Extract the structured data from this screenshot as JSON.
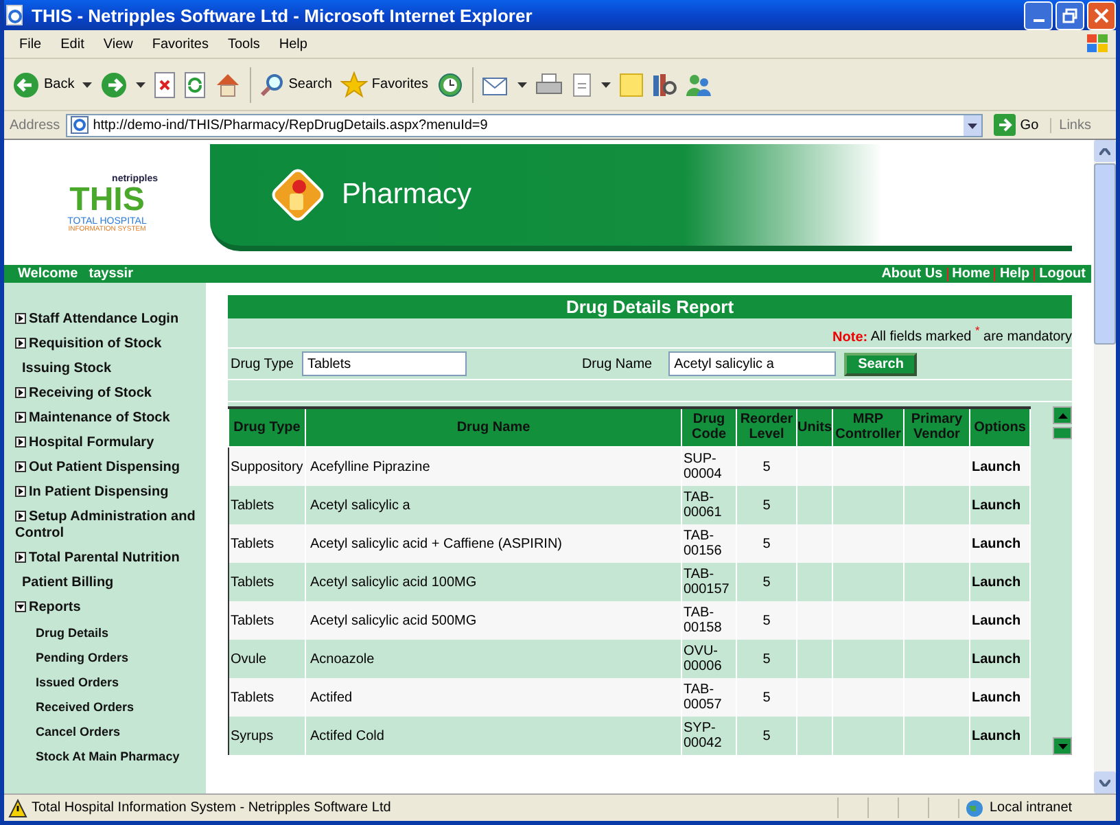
{
  "window": {
    "title": "THIS - Netripples Software Ltd - Microsoft Internet Explorer"
  },
  "menu": [
    "File",
    "Edit",
    "View",
    "Favorites",
    "Tools",
    "Help"
  ],
  "toolbar": {
    "back": "Back",
    "search": "Search",
    "favorites": "Favorites"
  },
  "address": {
    "label": "Address",
    "url": "http://demo-ind/THIS/Pharmacy/RepDrugDetails.aspx?menuId=9",
    "go": "Go",
    "links": "Links"
  },
  "header": {
    "logo": {
      "brand": "netripples",
      "name": "THIS",
      "line1": "TOTAL HOSPITAL",
      "line2": "INFORMATION SYSTEM"
    },
    "module": "Pharmacy"
  },
  "userbar": {
    "welcome": "Welcome",
    "user": "tayssir",
    "links": [
      "About Us",
      "Home",
      "Help",
      "Logout"
    ]
  },
  "sidebar": {
    "items": [
      {
        "label": "Staff Attendance Login",
        "kind": "toggle",
        "expanded": false
      },
      {
        "label": "Requisition of Stock",
        "kind": "toggle",
        "expanded": false
      },
      {
        "label": "Issuing Stock",
        "kind": "plain"
      },
      {
        "label": "Receiving of Stock",
        "kind": "toggle",
        "expanded": false
      },
      {
        "label": "Maintenance of Stock",
        "kind": "toggle",
        "expanded": false
      },
      {
        "label": "Hospital Formulary",
        "kind": "toggle",
        "expanded": false
      },
      {
        "label": "Out Patient Dispensing",
        "kind": "toggle",
        "expanded": false
      },
      {
        "label": "In Patient Dispensing",
        "kind": "toggle",
        "expanded": false
      },
      {
        "label": "Setup Administration and Control",
        "kind": "toggle",
        "expanded": false
      },
      {
        "label": "Total Parental Nutrition",
        "kind": "toggle",
        "expanded": false
      },
      {
        "label": "Patient Billing",
        "kind": "plain"
      },
      {
        "label": "Reports",
        "kind": "toggle",
        "expanded": true,
        "children": [
          {
            "label": "Drug Details"
          },
          {
            "label": "Pending Orders"
          },
          {
            "label": "Issued Orders"
          },
          {
            "label": "Received Orders"
          },
          {
            "label": "Cancel Orders"
          },
          {
            "label": "Stock At Main Pharmacy"
          }
        ]
      }
    ]
  },
  "report": {
    "title": "Drug Details Report",
    "note_label": "Note:",
    "note_text": "All fields marked $^{*}$ are mandatory",
    "filters": [
      {
        "label": "Drug Type",
        "value": "Tablets"
      },
      {
        "label": "Drug Name",
        "value": "Acetyl salicylic a"
      }
    ],
    "search_button": "Search",
    "table": {
      "columns": [
        "Drug Type",
        "Drug Name",
        "Drug Code",
        "Reorder Level",
        "Units",
        "MRP Controller",
        "Primary Vendor",
        "Options"
      ],
      "rows": [
        {
          "drug_type": "Suppository",
          "drug_name": "Acefylline Piprazine",
          "drug_code": "SUP-00004",
          "reorder_level": "5",
          "options": "Launch"
        },
        {
          "drug_type": "Tablets",
          "drug_name": "Acetyl salicylic a",
          "drug_code": "TAB-00061",
          "reorder_level": "5",
          "options": "Launch"
        },
        {
          "drug_type": "Tablets",
          "drug_name": "Acetyl salicylic acid + Caffiene (ASPIRIN)",
          "drug_code": "TAB-00156",
          "reorder_level": "5",
          "options": "Launch"
        },
        {
          "drug_type": "Tablets",
          "drug_name": "Acetyl salicylic acid 100MG",
          "drug_code": "TAB-000157",
          "reorder_level": "5",
          "options": "Launch"
        },
        {
          "drug_type": "Tablets",
          "drug_name": "Acetyl salicylic acid 500MG",
          "drug_code": "TAB-00158",
          "reorder_level": "5",
          "options": "Launch"
        },
        {
          "drug_type": "Ovule",
          "drug_name": "Acnoazole",
          "drug_code": "OVU-00006",
          "reorder_level": "5",
          "options": "Launch"
        },
        {
          "drug_type": "Tablets",
          "drug_name": "Actifed",
          "drug_code": "TAB-00057",
          "reorder_level": "5",
          "options": "Launch"
        },
        {
          "drug_type": "Syrups",
          "drug_name": "Actifed Cold",
          "drug_code": "SYP-00042",
          "reorder_level": "5",
          "options": "Launch"
        }
      ]
    }
  },
  "status_bar": {
    "text": "Total Hospital Information System - Netripples Software Ltd",
    "zone": "Local intranet"
  }
}
